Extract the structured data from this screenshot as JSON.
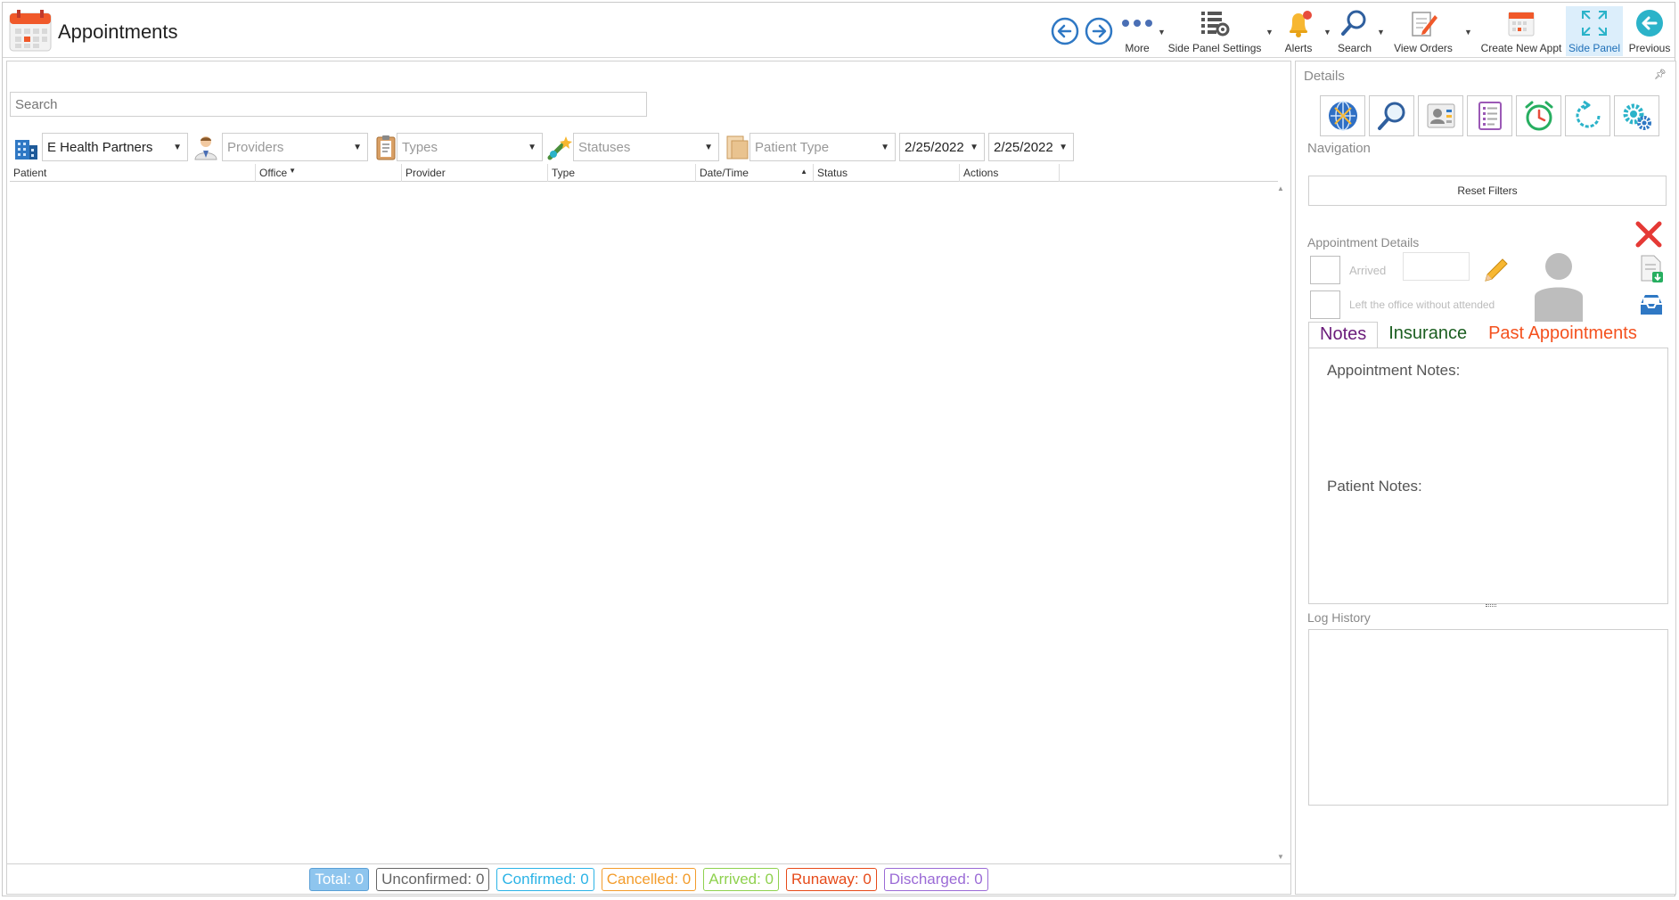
{
  "window": {
    "title": "Appointments"
  },
  "toolbar": {
    "more": "More",
    "side_panel_settings": "Side Panel Settings",
    "alerts": "Alerts",
    "search": "Search",
    "view_orders": "View Orders",
    "create_new_appt": "Create New Appt",
    "side_panel": "Side Panel",
    "previous": "Previous"
  },
  "search": {
    "placeholder": "Search"
  },
  "filters": {
    "office": "E Health Partners",
    "providers_placeholder": "Providers",
    "types_placeholder": "Types",
    "statuses_placeholder": "Statuses",
    "patient_type_placeholder": "Patient Type",
    "date_from": "2/25/2022",
    "date_to": "2/25/2022"
  },
  "grid": {
    "columns": [
      "Patient",
      "Office",
      "Provider",
      "Type",
      "Date/Time",
      "Status",
      "Actions"
    ],
    "rows": []
  },
  "status_bar": {
    "total": "Total: 0",
    "unconfirmed": "Unconfirmed: 0",
    "confirmed": "Confirmed: 0",
    "cancelled": "Cancelled: 0",
    "arrived": "Arrived: 0",
    "runaway": "Runaway: 0",
    "discharged": "Discharged: 0"
  },
  "colors": {
    "total": "#7fb8e6",
    "unconfirmed": "#666666",
    "confirmed": "#2bb3e6",
    "cancelled": "#f39c2b",
    "arrived": "#8fd14f",
    "runaway": "#e64a19",
    "discharged": "#9b6bd6",
    "accent": "#1e6fb8"
  },
  "side_panel": {
    "details_label": "Details",
    "navigation_label": "Navigation",
    "reset_filters": "Reset Filters",
    "appointment_details_label": "Appointment Details",
    "arrived_label": "Arrived",
    "left_office_label": "Left the office without attended",
    "tabs": {
      "notes": "Notes",
      "insurance": "Insurance",
      "past_appointments": "Past Appointments"
    },
    "appointment_notes_label": "Appointment Notes:",
    "patient_notes_label": "Patient Notes:",
    "log_history_label": "Log History"
  }
}
